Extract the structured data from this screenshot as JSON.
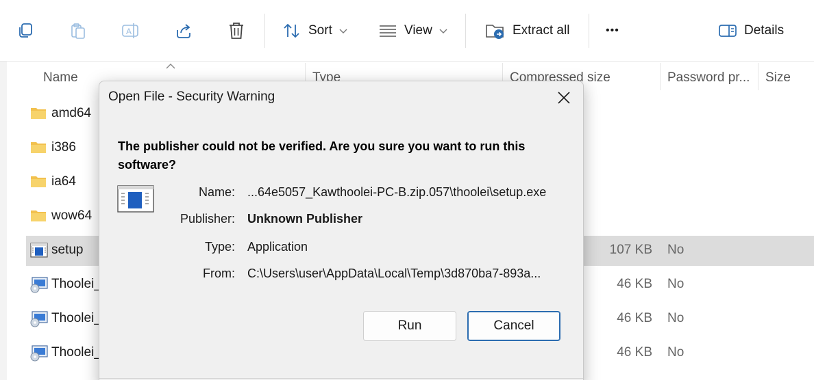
{
  "toolbar": {
    "copy_icon": "copy-icon",
    "paste_icon": "paste-icon",
    "rename_icon": "rename-icon",
    "share_icon": "share-icon",
    "delete_icon": "delete-icon",
    "sort_label": "Sort",
    "view_label": "View",
    "extract_label": "Extract all",
    "more_label": "•••",
    "details_label": "Details"
  },
  "columns": {
    "name": "Name",
    "type": "Type",
    "compressed_size": "Compressed size",
    "password": "Password pr...",
    "size": "Size"
  },
  "rows": [
    {
      "name": "amd64",
      "icon": "folder",
      "size": "",
      "password": ""
    },
    {
      "name": "i386",
      "icon": "folder",
      "size": "",
      "password": ""
    },
    {
      "name": "ia64",
      "icon": "folder",
      "size": "",
      "password": ""
    },
    {
      "name": "wow64",
      "icon": "folder",
      "size": "",
      "password": ""
    },
    {
      "name": "setup",
      "icon": "application",
      "size": "107 KB",
      "password": "No",
      "selected": true
    },
    {
      "name": "Thoolei_",
      "icon": "setup-disc",
      "size": "46 KB",
      "password": "No"
    },
    {
      "name": "Thoolei_",
      "icon": "setup-disc",
      "size": "46 KB",
      "password": "No"
    },
    {
      "name": "Thoolei_",
      "icon": "setup-disc",
      "size": "46 KB",
      "password": "No"
    }
  ],
  "dialog": {
    "title": "Open File - Security Warning",
    "warning": "The publisher could not be verified.  Are you sure you want to run this software?",
    "fields": {
      "name_label": "Name:",
      "name_value": "...64e5057_Kawthoolei-PC-B.zip.057\\thoolei\\setup.exe",
      "publisher_label": "Publisher:",
      "publisher_value": "Unknown Publisher",
      "type_label": "Type:",
      "type_value": "Application",
      "from_label": "From:",
      "from_value": "C:\\Users\\user\\AppData\\Local\\Temp\\3d870ba7-893a..."
    },
    "run_label": "Run",
    "cancel_label": "Cancel"
  },
  "colors": {
    "accent": "#2b6cb0",
    "selected_row": "#dcdcdc",
    "dialog_bg": "#f0f0f0",
    "folder": "#f2c14e"
  }
}
